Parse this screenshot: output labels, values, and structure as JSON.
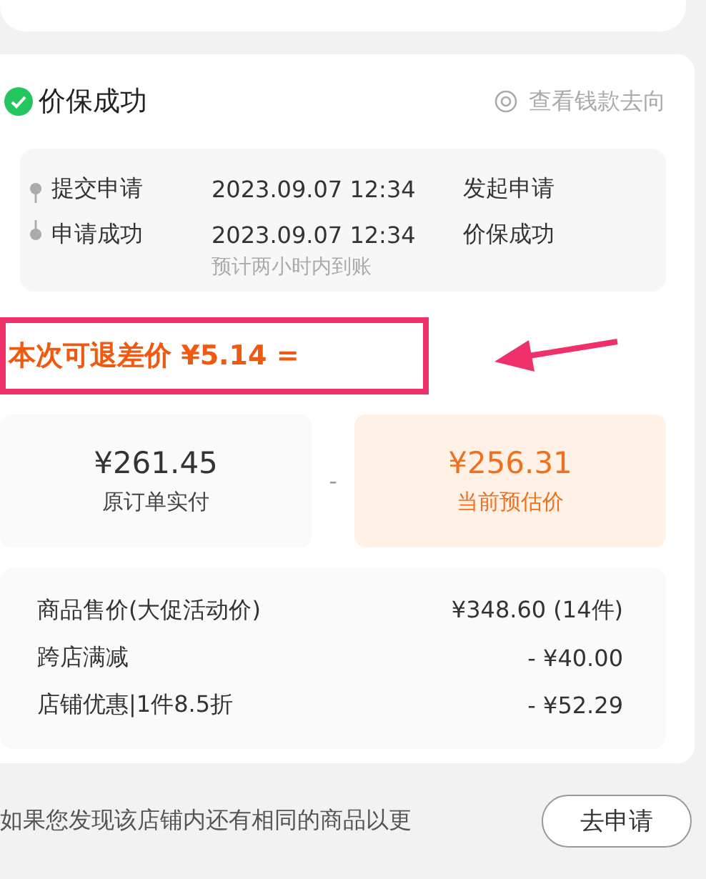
{
  "status": {
    "title": "价保成功",
    "link": "查看钱款去向"
  },
  "timeline": [
    {
      "step": "提交申请",
      "time": "2023.09.07 12:34",
      "result": "发起申请"
    },
    {
      "step": "申请成功",
      "time": "2023.09.07 12:34",
      "result": "价保成功",
      "note": "预计两小时内到账"
    }
  ],
  "refund": {
    "label": "本次可退差价",
    "amount": "¥5.14",
    "suffix": "="
  },
  "comparison": {
    "original": {
      "amount": "¥261.45",
      "label": "原订单实付"
    },
    "operator": "-",
    "current": {
      "amount": "¥256.31",
      "label": "当前预估价"
    }
  },
  "details": [
    {
      "label": "商品售价(大促活动价)",
      "value": "¥348.60 (14件)"
    },
    {
      "label": "跨店满减",
      "value": "- ¥40.00"
    },
    {
      "label": "店铺优惠|1件8.5折",
      "value": "- ¥52.29"
    }
  ],
  "footer": {
    "text": "如果您发现该店铺内还有相同的商品以更",
    "button": "去申请"
  }
}
